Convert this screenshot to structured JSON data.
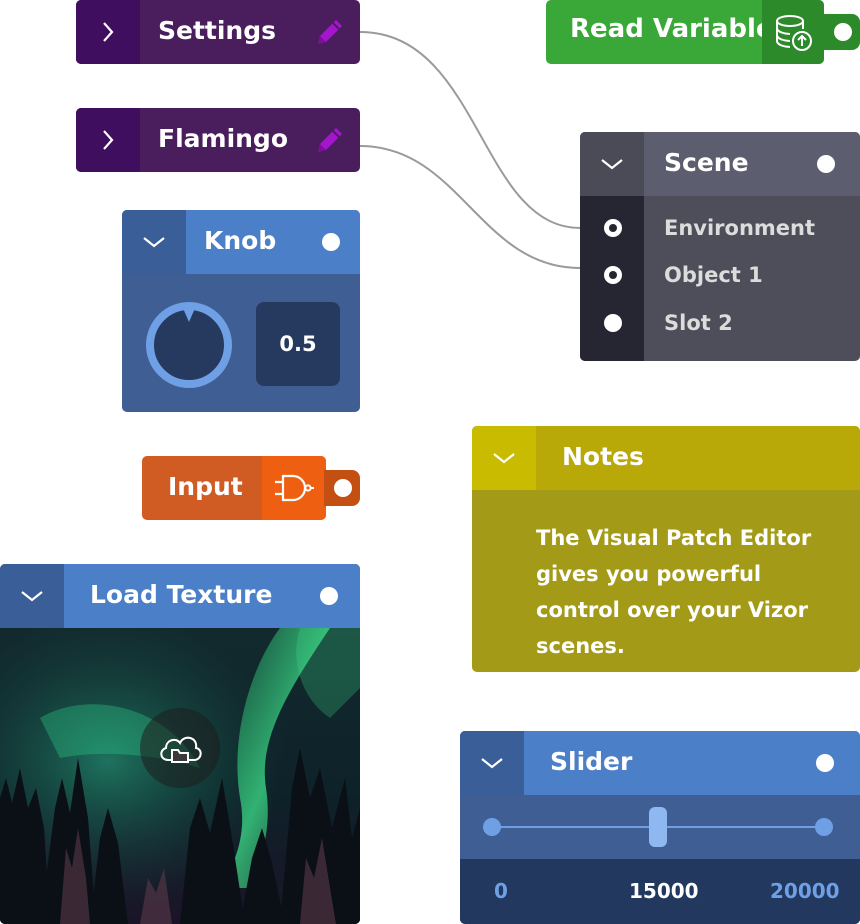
{
  "nodes": {
    "settings": {
      "title": "Settings"
    },
    "flamingo": {
      "title": "Flamingo"
    },
    "read_variable": {
      "title": "Read Variable"
    },
    "scene": {
      "title": "Scene",
      "slots": [
        "Environment",
        "Object 1",
        "Slot 2"
      ]
    },
    "knob": {
      "title": "Knob",
      "value": "0.5"
    },
    "input": {
      "title": "Input"
    },
    "load_texture": {
      "title": "Load Texture"
    },
    "notes": {
      "title": "Notes",
      "body": "The Visual Patch Editor gives you powerful control over your Vizor scenes."
    },
    "slider": {
      "title": "Slider",
      "min_label": "0",
      "value_label": "15000",
      "max_label": "20000",
      "level": 0.5
    }
  },
  "colors": {
    "purple_node": "#4a1d5c",
    "pencil": "#a316c9",
    "green_node": "#3aa838",
    "scene_node": "#4e4e5a",
    "blue_node": "#4b7fc7",
    "orange_node": "#d05c23",
    "notes_node": "#a39a18",
    "connection": "#9a9a9a"
  },
  "icons": {
    "expand": "chevron-right-icon",
    "collapse": "chevron-down-icon",
    "edit": "pencil-icon",
    "database_upload": "database-upload-icon",
    "logic_gate": "and-gate-icon",
    "cloud_folder": "cloud-folder-icon"
  }
}
